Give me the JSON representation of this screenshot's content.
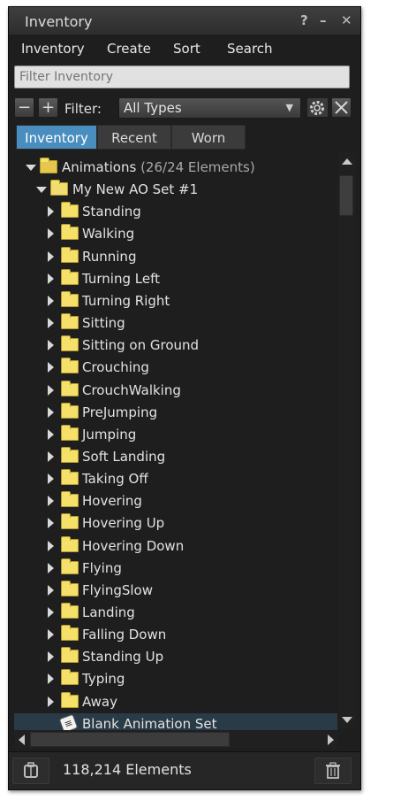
{
  "window": {
    "title": "Inventory",
    "help_label": "?",
    "minimize_label": "–",
    "close_label": "✕"
  },
  "menu": [
    "Inventory",
    "Create",
    "Sort",
    "Search"
  ],
  "filter": {
    "placeholder": "Filter Inventory",
    "label": "Filter:",
    "type_value": "All Types",
    "minus_label": "−",
    "plus_label": "+"
  },
  "tabs": [
    {
      "label": "Inventory",
      "active": true
    },
    {
      "label": "Recent",
      "active": false
    },
    {
      "label": "Worn",
      "active": false
    }
  ],
  "tree": {
    "root": {
      "label": "Animations",
      "count": "(26/24 Elements)"
    },
    "set": {
      "label": "My New AO Set #1"
    },
    "folders": [
      "Standing",
      "Walking",
      "Running",
      "Turning Left",
      "Turning Right",
      "Sitting",
      "Sitting on Ground",
      "Crouching",
      "CrouchWalking",
      "PreJumping",
      "Jumping",
      "Soft Landing",
      "Taking Off",
      "Hovering",
      "Hovering Up",
      "Hovering Down",
      "Flying",
      "FlyingSlow",
      "Landing",
      "Falling Down",
      "Standing Up",
      "Typing",
      "Away"
    ],
    "selected_item": {
      "label": "Blank Animation Set",
      "icon": "animation-icon"
    }
  },
  "status": {
    "count_text": "118,214 Elements"
  },
  "colors": {
    "accent": "#4a8ec0",
    "background": "#1e1e1e",
    "folder": "#f5e06a"
  }
}
